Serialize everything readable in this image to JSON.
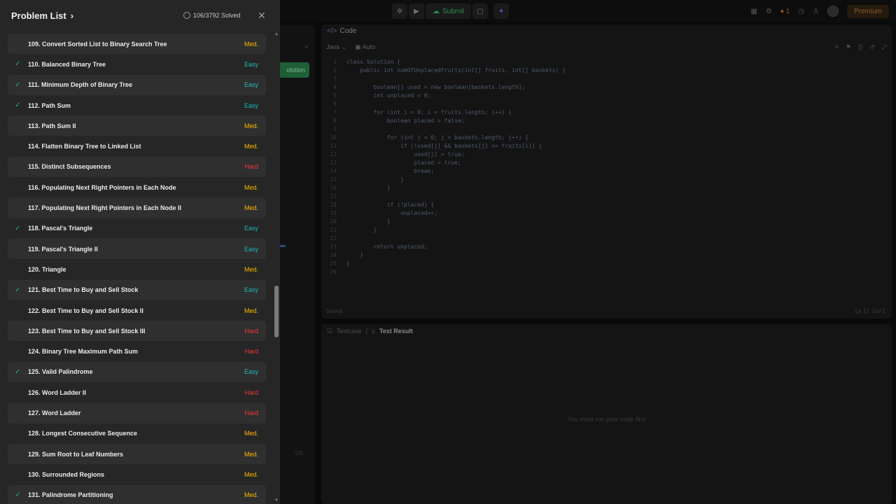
{
  "topbar": {
    "submit_label": "Submit",
    "streak": "1",
    "premium": "Premium"
  },
  "left_panel": {
    "solution_label": "olution",
    "testcase_count": "0/5"
  },
  "code": {
    "header": "Code",
    "language": "Java",
    "mode": "Auto",
    "lines": [
      "class Solution {",
      "    public int numOfUnplacedFruits(int[] fruits, int[] baskets) {",
      "",
      "        boolean[] used = new boolean[baskets.length];",
      "        int unplaced = 0;",
      "",
      "        for (int i = 0; i < fruits.length; i++) {",
      "            boolean placed = false;",
      "",
      "            for (int j = 0; j < baskets.length; j++) {",
      "                if (!used[j] && baskets[j] >= fruits[i]) {",
      "                    used[j] = true;",
      "                    placed = true;",
      "                    break;",
      "                }",
      "            }",
      "",
      "            if (!placed) {",
      "                unplaced++;",
      "            }",
      "        }",
      "",
      "        return unplaced;",
      "    }",
      "}",
      ""
    ],
    "status": "Saved",
    "cursor": "Ln 17, Col 1"
  },
  "result": {
    "tab_testcase": "Testcase",
    "tab_result": "Test Result",
    "message": "You must run your code first"
  },
  "drawer": {
    "title": "Problem List",
    "solved": "106/3792 Solved",
    "problems": [
      {
        "title": "109. Convert Sorted List to Binary Search Tree",
        "difficulty": "Med.",
        "level": "medium",
        "solved": false
      },
      {
        "title": "110. Balanced Binary Tree",
        "difficulty": "Easy",
        "level": "easy",
        "solved": true
      },
      {
        "title": "111. Minimum Depth of Binary Tree",
        "difficulty": "Easy",
        "level": "easy",
        "solved": true
      },
      {
        "title": "112. Path Sum",
        "difficulty": "Easy",
        "level": "easy",
        "solved": true
      },
      {
        "title": "113. Path Sum II",
        "difficulty": "Med.",
        "level": "medium",
        "solved": false
      },
      {
        "title": "114. Flatten Binary Tree to Linked List",
        "difficulty": "Med.",
        "level": "medium",
        "solved": false
      },
      {
        "title": "115. Distinct Subsequences",
        "difficulty": "Hard",
        "level": "hard",
        "solved": false
      },
      {
        "title": "116. Populating Next Right Pointers in Each Node",
        "difficulty": "Med.",
        "level": "medium",
        "solved": false
      },
      {
        "title": "117. Populating Next Right Pointers in Each Node II",
        "difficulty": "Med.",
        "level": "medium",
        "solved": false
      },
      {
        "title": "118. Pascal's Triangle",
        "difficulty": "Easy",
        "level": "easy",
        "solved": true
      },
      {
        "title": "119. Pascal's Triangle II",
        "difficulty": "Easy",
        "level": "easy",
        "solved": false
      },
      {
        "title": "120. Triangle",
        "difficulty": "Med.",
        "level": "medium",
        "solved": false
      },
      {
        "title": "121. Best Time to Buy and Sell Stock",
        "difficulty": "Easy",
        "level": "easy",
        "solved": true
      },
      {
        "title": "122. Best Time to Buy and Sell Stock II",
        "difficulty": "Med.",
        "level": "medium",
        "solved": false
      },
      {
        "title": "123. Best Time to Buy and Sell Stock III",
        "difficulty": "Hard",
        "level": "hard",
        "solved": false
      },
      {
        "title": "124. Binary Tree Maximum Path Sum",
        "difficulty": "Hard",
        "level": "hard",
        "solved": false
      },
      {
        "title": "125. Valid Palindrome",
        "difficulty": "Easy",
        "level": "easy",
        "solved": true
      },
      {
        "title": "126. Word Ladder II",
        "difficulty": "Hard",
        "level": "hard",
        "solved": false
      },
      {
        "title": "127. Word Ladder",
        "difficulty": "Hard",
        "level": "hard",
        "solved": false
      },
      {
        "title": "128. Longest Consecutive Sequence",
        "difficulty": "Med.",
        "level": "medium",
        "solved": false
      },
      {
        "title": "129. Sum Root to Leaf Numbers",
        "difficulty": "Med.",
        "level": "medium",
        "solved": false
      },
      {
        "title": "130. Surrounded Regions",
        "difficulty": "Med.",
        "level": "medium",
        "solved": false
      },
      {
        "title": "131. Palindrome Partitioning",
        "difficulty": "Med.",
        "level": "medium",
        "solved": true
      }
    ]
  }
}
